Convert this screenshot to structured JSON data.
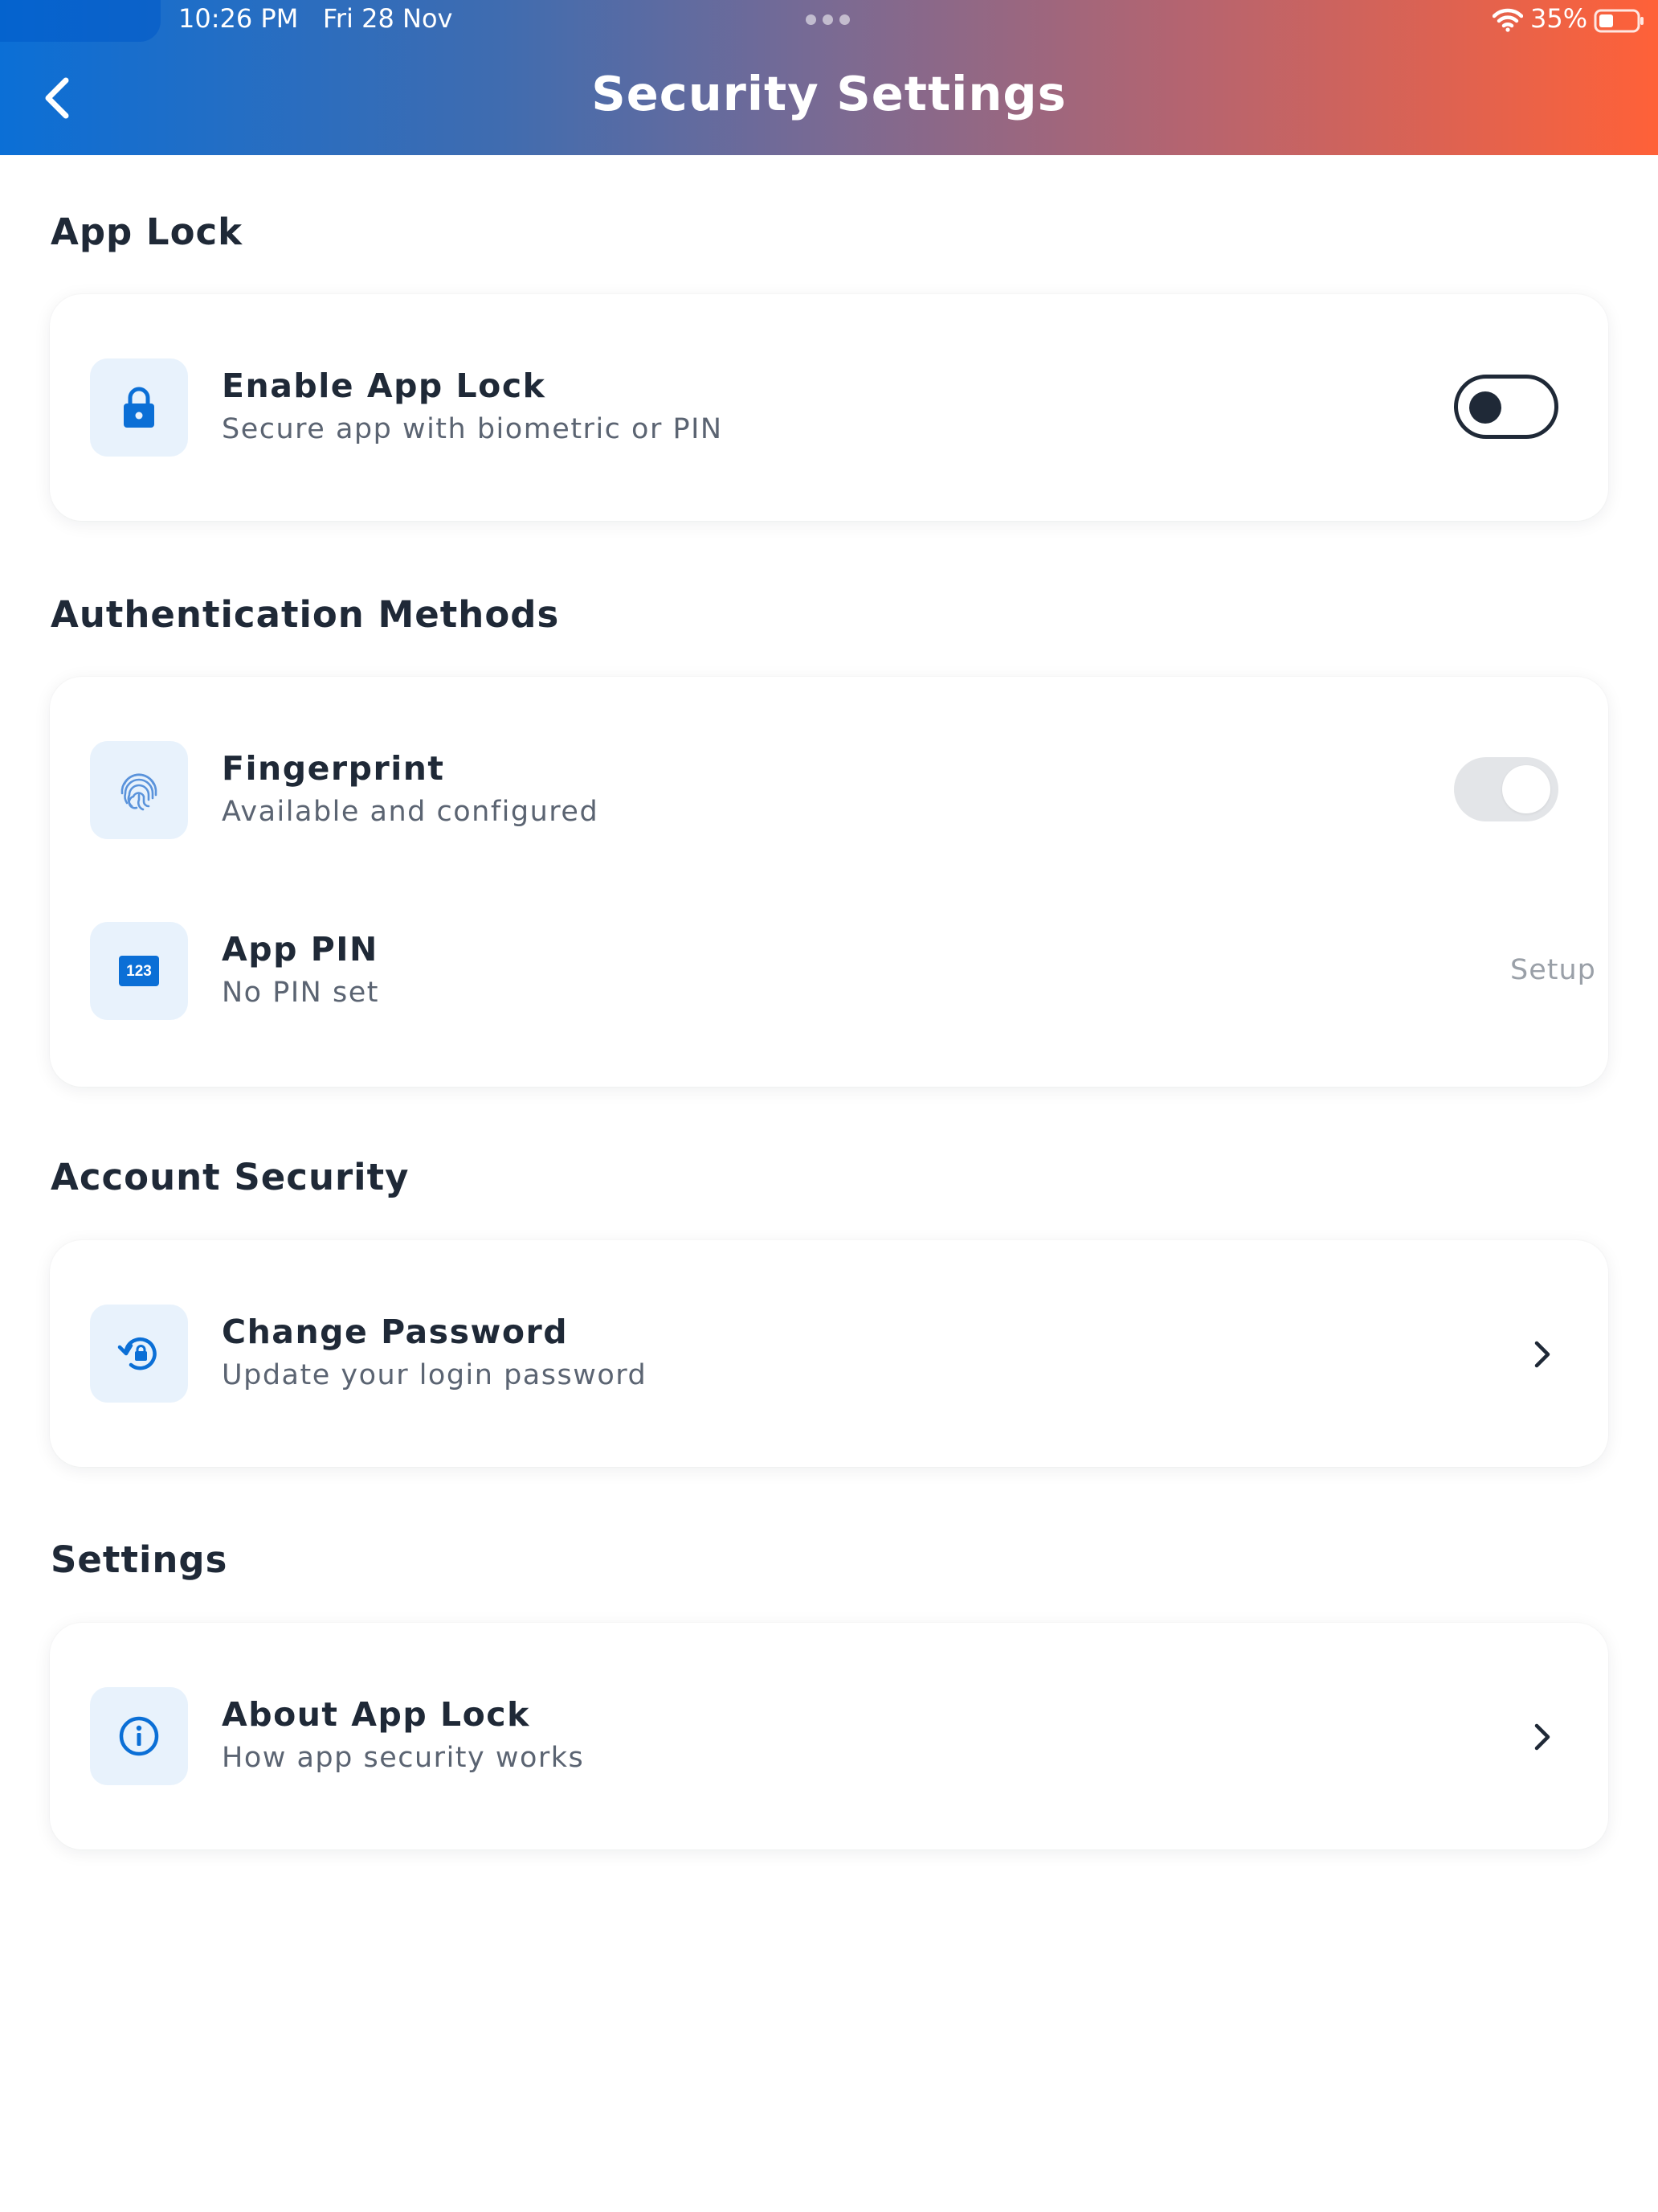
{
  "status_bar": {
    "time": "10:26 PM",
    "date": "Fri 28 Nov",
    "battery": "35%"
  },
  "header": {
    "title": "Security Settings"
  },
  "sections": {
    "app_lock": {
      "title": "App Lock",
      "enable": {
        "title": "Enable App Lock",
        "subtitle": "Secure app with biometric or PIN",
        "icon": "lock-icon",
        "state": "off"
      }
    },
    "auth_methods": {
      "title": "Authentication Methods",
      "fingerprint": {
        "title": "Fingerprint",
        "subtitle": "Available and configured",
        "icon": "fingerprint-icon",
        "state": "disabled"
      },
      "pin": {
        "title": "App PIN",
        "subtitle": "No PIN set",
        "icon": "pin-123-icon",
        "icon_text": "123",
        "action": "Setup"
      }
    },
    "account_security": {
      "title": "Account Security",
      "change_password": {
        "title": "Change Password",
        "subtitle": "Update your login password",
        "icon": "lock-reset-icon"
      }
    },
    "settings": {
      "title": "Settings",
      "about": {
        "title": "About App Lock",
        "subtitle": "How app security works",
        "icon": "info-icon"
      }
    }
  },
  "colors": {
    "accent": "#0b6fd6",
    "icon_bg": "#e8f2fc",
    "header_gradient_start": "#0b6fd6",
    "header_gradient_end": "#ff6138",
    "text_primary": "#1f2937",
    "text_secondary": "#5b6472",
    "muted": "#9aa0a8"
  }
}
